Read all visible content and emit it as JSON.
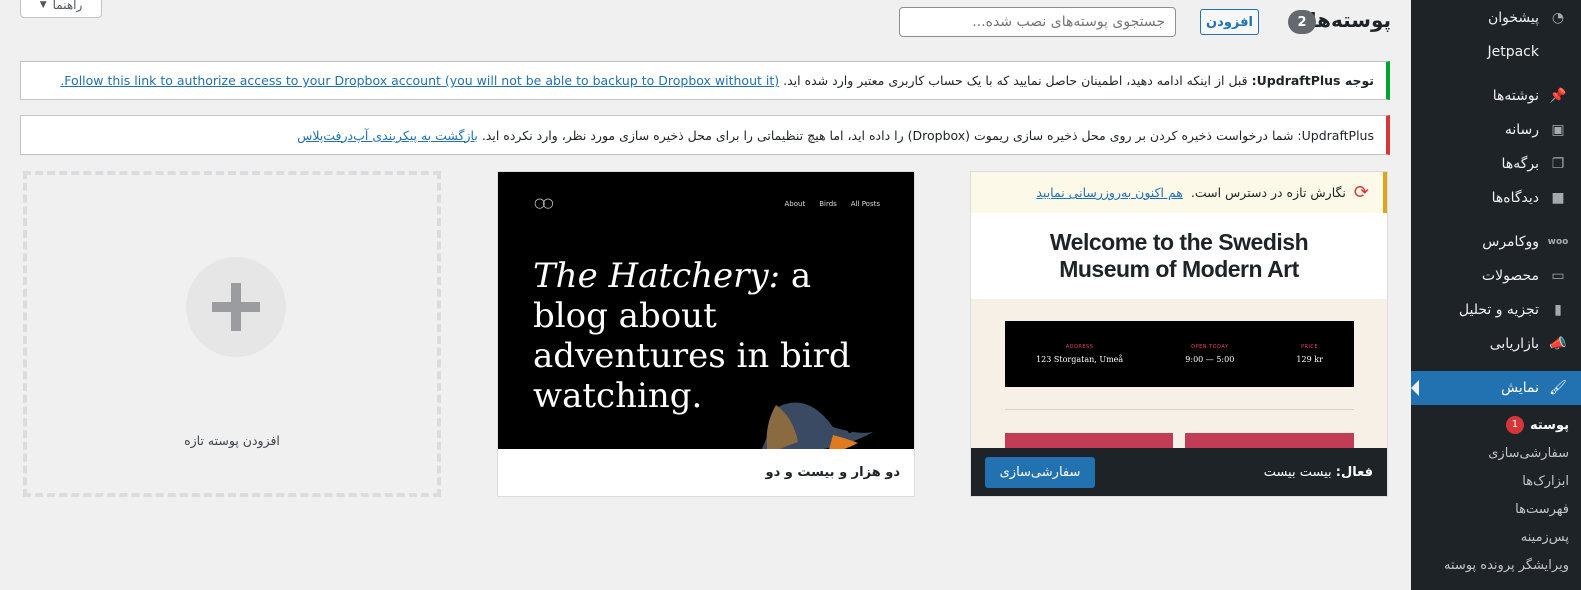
{
  "sidebar": {
    "items": [
      {
        "label": "پیشخوان",
        "icon": "dashboard-icon"
      },
      {
        "label": "Jetpack",
        "icon": "jetpack-icon"
      },
      {
        "label": "نوشته‌ها",
        "icon": "pin-icon"
      },
      {
        "label": "رسانه",
        "icon": "media-icon"
      },
      {
        "label": "برگه‌ها",
        "icon": "pages-icon"
      },
      {
        "label": "دیدگاه‌ها",
        "icon": "comments-icon"
      },
      {
        "label": "ووکامرس",
        "icon": "woocommerce-icon"
      },
      {
        "label": "محصولات",
        "icon": "products-icon"
      },
      {
        "label": "تجزیه و تحلیل",
        "icon": "analytics-icon"
      },
      {
        "label": "بازاریابی",
        "icon": "megaphone-icon"
      },
      {
        "label": "نمایش",
        "icon": "appearance-brush-icon"
      }
    ],
    "submenu": [
      {
        "label": "پوسته",
        "badge": "1"
      },
      {
        "label": "سفارشی‌سازی"
      },
      {
        "label": "ابزارک‌ها"
      },
      {
        "label": "فهرست‌ها"
      },
      {
        "label": "پس‌زمینه"
      },
      {
        "label": "ویرایشگر پرونده پوسته"
      }
    ]
  },
  "header": {
    "title": "پوسته‌ها",
    "count": "2",
    "add_label": "افزودن",
    "search_placeholder": "جستجوی پوسته‌های نصب شده...",
    "help_label": "راهنما"
  },
  "notices": {
    "dropbox_prefix": "توجه UpdraftPlus:",
    "dropbox_text": "قبل از اینکه ادامه دهید، اطمینان حاصل نمایید که با یک حساب کاربری معتبر وارد شده اید.",
    "dropbox_link": "Follow this link to authorize access to your Dropbox account (you will not be able to backup to Dropbox without it).",
    "remote_text": "UpdraftPlus: شما درخواست ذخیره کردن بر روی محل ذخیره سازی ریموت (Dropbox) را داده اید، اما هیچ تنظیماتی را برای محل ذخیره سازی مورد نظر، وارد نکرده اید.",
    "remote_link": "بازگشت به پیکربندی آپ‌درفت‌پلاس"
  },
  "themes": {
    "active": {
      "update_text": "نگارش تازه در دسترس است.",
      "update_link": "هم اکنون به‌روزرسانی نمایید",
      "preview_title": "Welcome to the Swedish Museum of Modern Art",
      "info": [
        {
          "label": "ADDRESS",
          "value": "123 Storgatan, Umeå"
        },
        {
          "label": "OPEN TODAY",
          "value": "9:00 — 5:00"
        },
        {
          "label": "PRICE",
          "value": "129 kr"
        }
      ],
      "active_prefix": "فعال:",
      "name": "بیست بیست",
      "customize_label": "سفارشی‌سازی"
    },
    "second": {
      "nav": [
        "About",
        "Birds",
        "All Posts"
      ],
      "headline_italic": "The Hatchery:",
      "headline_rest": "a blog about adventures in bird watching.",
      "name": "دو هزار و بیست و دو"
    },
    "add_new_label": "افزودن پوسته تازه"
  },
  "colors": {
    "sidebar_bg": "#1d2327",
    "accent": "#2271b1",
    "notice_success": "#00a32a",
    "notice_error": "#d63638",
    "notice_warning": "#dba617"
  }
}
